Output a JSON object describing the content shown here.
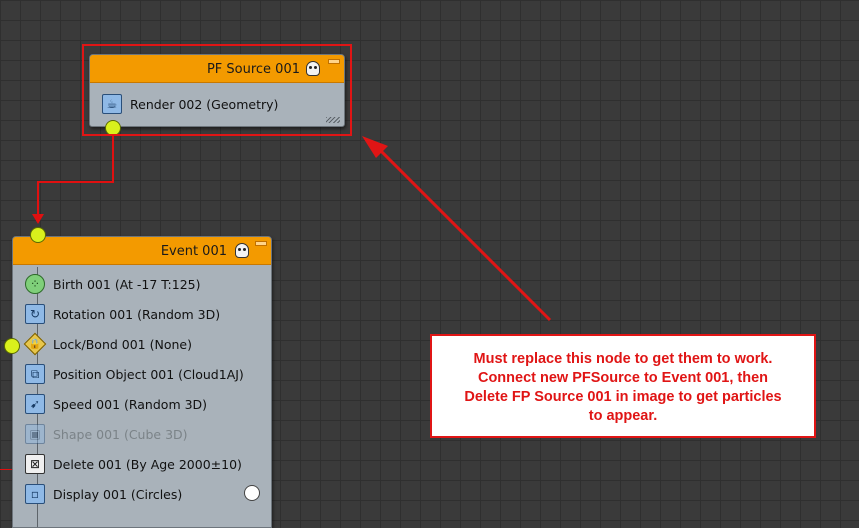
{
  "source_node": {
    "title": "PF Source 001",
    "rows": [
      {
        "label": "Render 002 (Geometry)",
        "icon": "teapot-icon"
      }
    ]
  },
  "event_node": {
    "title": "Event 001",
    "rows": [
      {
        "label": "Birth 001 (At -17 T:125)",
        "icon": "birth-icon"
      },
      {
        "label": "Rotation 001 (Random 3D)",
        "icon": "rotation-icon"
      },
      {
        "label": "Lock/Bond 001 (None)",
        "icon": "lock-icon"
      },
      {
        "label": "Position Object 001 (Cloud1AJ)",
        "icon": "position-object-icon"
      },
      {
        "label": "Speed 001 (Random 3D)",
        "icon": "speed-icon"
      },
      {
        "label": "Shape 001 (Cube 3D)",
        "icon": "shape-icon",
        "disabled": true
      },
      {
        "label": "Delete 001 (By Age 2000±10)",
        "icon": "delete-icon"
      },
      {
        "label": "Display 001 (Circles)",
        "icon": "display-icon"
      }
    ]
  },
  "callout": {
    "lines": [
      "Must replace this node to get them to work.",
      "Connect new PFSource to Event 001, then",
      "Delete FP Source 001 in image to get particles",
      "to appear."
    ]
  },
  "colors": {
    "header": "#f39a00",
    "node_body": "#a9b2ba",
    "socket": "#d9f01c",
    "annotation_red": "#e01515",
    "background": "#3a3a3a"
  }
}
